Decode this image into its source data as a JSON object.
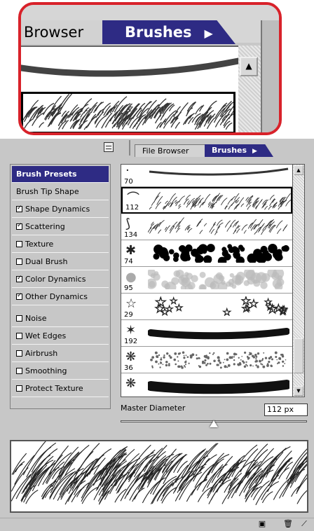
{
  "zoom": {
    "tabs": {
      "file_browser": "Browser",
      "brushes": "Brushes",
      "arrow": "▶"
    }
  },
  "palette": {
    "tabs": {
      "file_browser": "File Browser",
      "brushes": "Brushes",
      "arrow": "▶"
    },
    "left_panel": {
      "header": "Brush Presets",
      "items": [
        {
          "label": "Brush Tip Shape",
          "checkbox": false
        },
        {
          "label": "Shape Dynamics",
          "checkbox": true,
          "checked": true
        },
        {
          "label": "Scattering",
          "checkbox": true,
          "checked": true
        },
        {
          "label": "Texture",
          "checkbox": true,
          "checked": false
        },
        {
          "label": "Dual Brush",
          "checkbox": true,
          "checked": false
        },
        {
          "label": "Color Dynamics",
          "checkbox": true,
          "checked": true
        },
        {
          "label": "Other Dynamics",
          "checkbox": true,
          "checked": true
        },
        {
          "label": "Noise",
          "checkbox": true,
          "checked": false
        },
        {
          "label": "Wet Edges",
          "checkbox": true,
          "checked": false
        },
        {
          "label": "Airbrush",
          "checkbox": true,
          "checked": false
        },
        {
          "label": "Smoothing",
          "checkbox": true,
          "checked": false
        },
        {
          "label": "Protect Texture",
          "checkbox": true,
          "checked": false
        }
      ]
    },
    "brushes": [
      {
        "size": "70",
        "kind": "line"
      },
      {
        "size": "112",
        "kind": "grass",
        "selected": true
      },
      {
        "size": "134",
        "kind": "grass-thin"
      },
      {
        "size": "74",
        "kind": "leaves"
      },
      {
        "size": "95",
        "kind": "dapple"
      },
      {
        "size": "29",
        "kind": "stars"
      },
      {
        "size": "192",
        "kind": "soft"
      },
      {
        "size": "36",
        "kind": "chalk"
      },
      {
        "size": "",
        "kind": "dark"
      }
    ],
    "master_diameter": {
      "label": "Master Diameter",
      "value": "112 px",
      "fraction": 0.5
    }
  }
}
